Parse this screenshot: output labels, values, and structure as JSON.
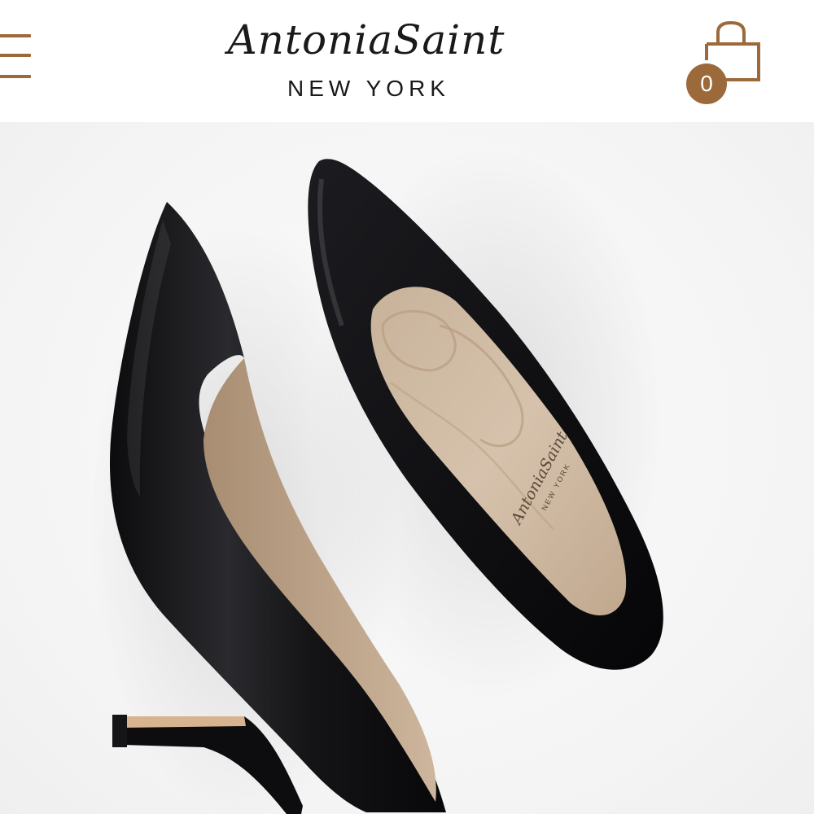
{
  "header": {
    "menu_icon": "hamburger-menu-icon",
    "logo": {
      "brand_script": "AntoniaSaint",
      "brand_sub": "NEW YORK"
    },
    "cart": {
      "icon": "shopping-bag-icon",
      "count": "0"
    }
  },
  "colors": {
    "accent": "#9c6a3a",
    "text": "#1a1a1a",
    "background": "#ffffff"
  },
  "hero": {
    "image": "black-leather-pointed-pumps-photo",
    "insole_brand_script": "AntoniaSaint",
    "insole_brand_sub": "NEW YORK"
  }
}
